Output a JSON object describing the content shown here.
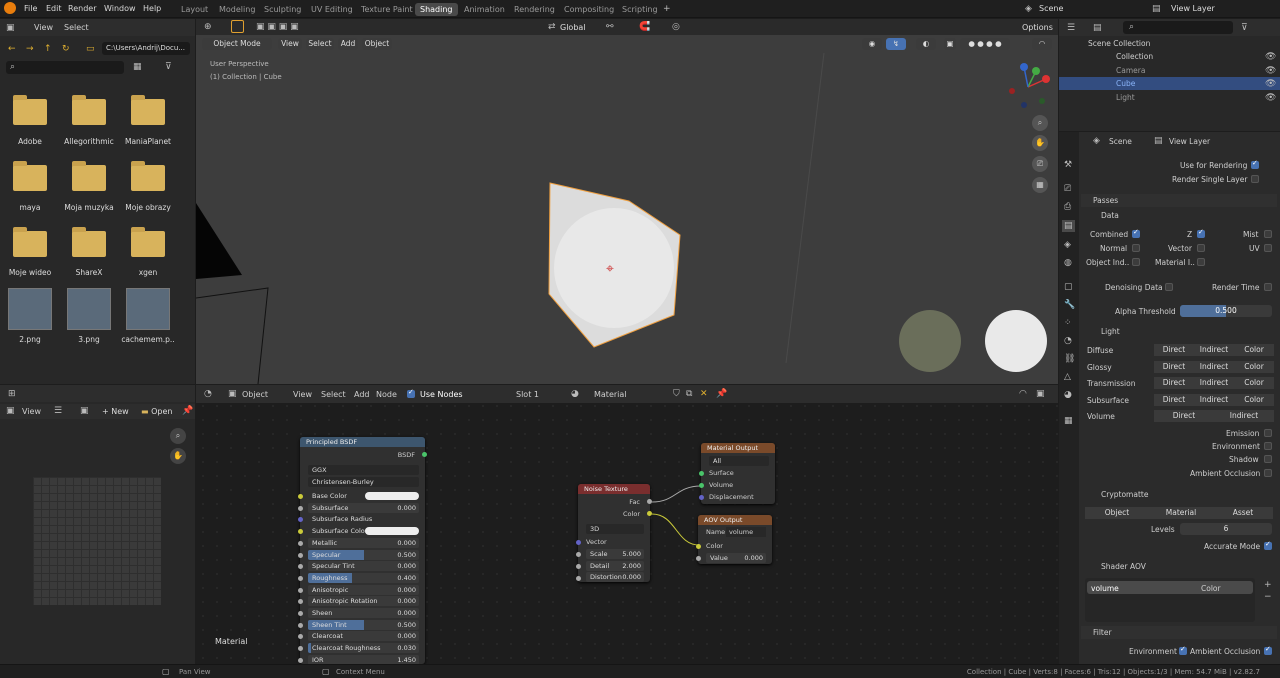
{
  "topmenu": {
    "file": "File",
    "edit": "Edit",
    "render": "Render",
    "window": "Window",
    "help": "Help"
  },
  "workspaces": [
    "Layout",
    "Modeling",
    "Sculpting",
    "UV Editing",
    "Texture Paint",
    "Shading",
    "Animation",
    "Rendering",
    "Compositing",
    "Scripting"
  ],
  "scene": {
    "scene_name": "Scene",
    "view_layer": "View Layer"
  },
  "filebrowser": {
    "view": "View",
    "select": "Select",
    "path": "C:\\Users\\Andrij\\Docu...",
    "items": [
      "Adobe",
      "Allegorithmic",
      "ManiaPlanet",
      "maya",
      "Moja muzyka",
      "Moje obrazy",
      "Moje wideo",
      "ShareX",
      "xgen",
      "2.png",
      "3.png",
      "cachemem.p.."
    ]
  },
  "viewport": {
    "global": "Global",
    "options": "Options",
    "mode": "Object Mode",
    "view": "View",
    "select": "Select",
    "add": "Add",
    "object": "Object",
    "info1": "User Perspective",
    "info2": "(1) Collection | Cube"
  },
  "outliner": {
    "root": "Scene Collection",
    "collection": "Collection",
    "items": [
      "Camera",
      "Cube",
      "Light"
    ]
  },
  "properties": {
    "scene": "Scene",
    "view_layer": "View Layer",
    "use_for_rendering": "Use for Rendering",
    "render_single_layer": "Render Single Layer",
    "passes": "Passes",
    "data": "Data",
    "combined": "Combined",
    "z": "Z",
    "mist": "Mist",
    "normal": "Normal",
    "vector": "Vector",
    "uv": "UV",
    "object_ind": "Object Ind..",
    "material_i": "Material I..",
    "denoising_data": "Denoising Data",
    "render_time": "Render Time",
    "alpha_threshold": "Alpha Threshold",
    "alpha_value": "0.500",
    "alpha_fraction": 0.5,
    "light": "Light",
    "light_rows": [
      "Diffuse",
      "Glossy",
      "Transmission",
      "Subsurface"
    ],
    "direct": "Direct",
    "indirect": "Indirect",
    "color": "Color",
    "volume": "Volume",
    "emission": "Emission",
    "environment": "Environment",
    "shadow": "Shadow",
    "ambient_occlusion": "Ambient Occlusion",
    "cryptomatte": "Cryptomatte",
    "c_object": "Object",
    "c_material": "Material",
    "c_asset": "Asset",
    "levels": "Levels",
    "levels_value": "6",
    "accurate_mode": "Accurate Mode",
    "shader_aov": "Shader AOV",
    "aov_name": "volume",
    "aov_type": "Color",
    "filter": "Filter",
    "f_environment": "Environment",
    "f_ao": "Ambient Occlusion"
  },
  "imageeditor": {
    "view": "View",
    "new": "New",
    "open": "Open"
  },
  "nodeeditor": {
    "object": "Object",
    "view": "View",
    "select": "Select",
    "add": "Add",
    "node": "Node",
    "use_nodes": "Use Nodes",
    "slot": "Slot 1",
    "material": "Material",
    "label": "Material"
  },
  "bsdf": {
    "title": "Principled BSDF",
    "out": "BSDF",
    "dist": "GGX",
    "sss": "Christensen-Burley",
    "rows": [
      {
        "name": "Base Color",
        "value": "",
        "type": "color"
      },
      {
        "name": "Subsurface",
        "value": "0.000",
        "fill": 0
      },
      {
        "name": "Subsurface Radius",
        "value": "",
        "type": "vec"
      },
      {
        "name": "Subsurface Color",
        "value": "",
        "type": "color"
      },
      {
        "name": "Metallic",
        "value": "0.000",
        "fill": 0
      },
      {
        "name": "Specular",
        "value": "0.500",
        "fill": 0.5
      },
      {
        "name": "Specular Tint",
        "value": "0.000",
        "fill": 0
      },
      {
        "name": "Roughness",
        "value": "0.400",
        "fill": 0.4
      },
      {
        "name": "Anisotropic",
        "value": "0.000",
        "fill": 0
      },
      {
        "name": "Anisotropic Rotation",
        "value": "0.000",
        "fill": 0
      },
      {
        "name": "Sheen",
        "value": "0.000",
        "fill": 0
      },
      {
        "name": "Sheen Tint",
        "value": "0.500",
        "fill": 0.5
      },
      {
        "name": "Clearcoat",
        "value": "0.000",
        "fill": 0
      },
      {
        "name": "Clearcoat Roughness",
        "value": "0.030",
        "fill": 0.03
      },
      {
        "name": "IOR",
        "value": "1.450",
        "fill": 0
      }
    ]
  },
  "noise": {
    "title": "Noise Texture",
    "fac": "Fac",
    "color": "Color",
    "dim": "3D",
    "vector": "Vector",
    "scale": "Scale",
    "scale_v": "5.000",
    "detail": "Detail",
    "detail_v": "2.000",
    "distortion": "Distortion",
    "distortion_v": "0.000"
  },
  "matout": {
    "title": "Material Output",
    "target": "All",
    "surface": "Surface",
    "volume": "Volume",
    "displacement": "Displacement"
  },
  "aov": {
    "title": "AOV Output",
    "name_label": "Name",
    "name": "volume",
    "color": "Color",
    "value": "Value",
    "value_v": "0.000"
  },
  "statusbar": {
    "pan": "Pan View",
    "context": "Context Menu",
    "stats": "Collection | Cube | Verts:8 | Faces:6 | Tris:12 | Objects:1/3 | Mem: 54.7 MiB | v2.82.7"
  }
}
